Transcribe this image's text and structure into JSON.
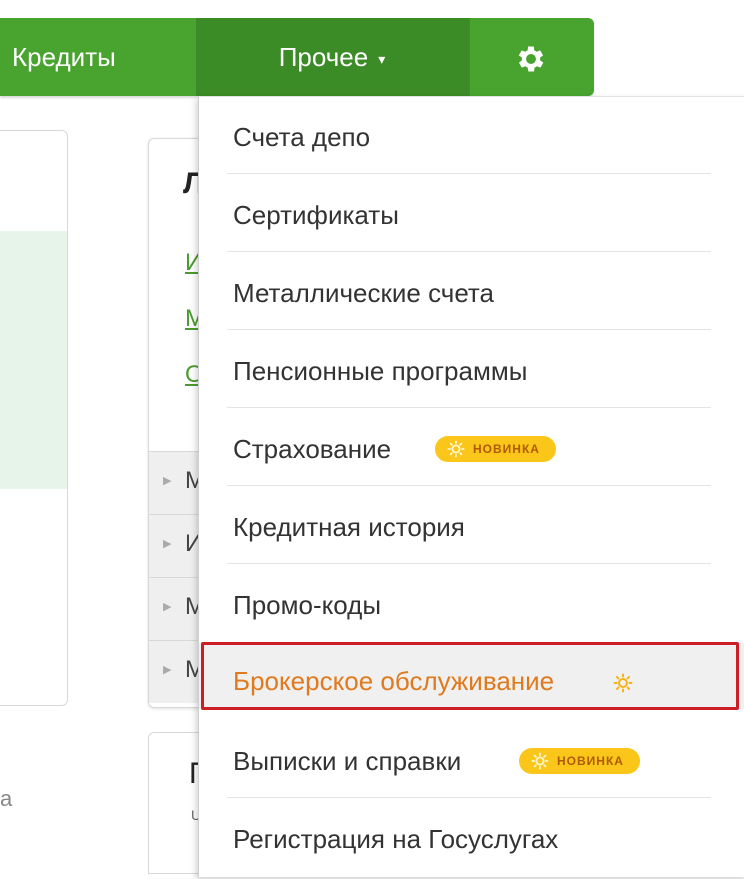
{
  "nav": {
    "credits": "Кредиты",
    "other": "Прочее",
    "other_caret": "▾",
    "settings_icon": "gear-icon",
    "bar_color": "#48a42f",
    "active_color": "#3b8b27"
  },
  "background": {
    "mid_title": "Л",
    "mid_links": [
      "И",
      "М",
      "О"
    ],
    "mid_rows": [
      "М",
      "И",
      "М",
      "М"
    ],
    "bottom_title": "П",
    "bottom_small": "U",
    "corner_text": "а"
  },
  "dropdown": {
    "items": [
      {
        "label": "Счета депо"
      },
      {
        "label": "Сертификаты"
      },
      {
        "label": "Металлические счета"
      },
      {
        "label": "Пенсионные программы"
      },
      {
        "label": "Страхование",
        "badge": "НОВИНКА"
      },
      {
        "label": "Кредитная история"
      },
      {
        "label": "Промо-коды"
      },
      {
        "label": "Брокерское обслуживание",
        "highlighted": true,
        "icon": "sun-icon"
      },
      {
        "label": "Выписки и справки",
        "badge": "НОВИНКА"
      },
      {
        "label": "Регистрация на Госуслугах"
      }
    ],
    "badge_color": "#f9c619",
    "highlight_text_color": "#e07a1c",
    "highlight_border_color": "#cc1f25"
  }
}
